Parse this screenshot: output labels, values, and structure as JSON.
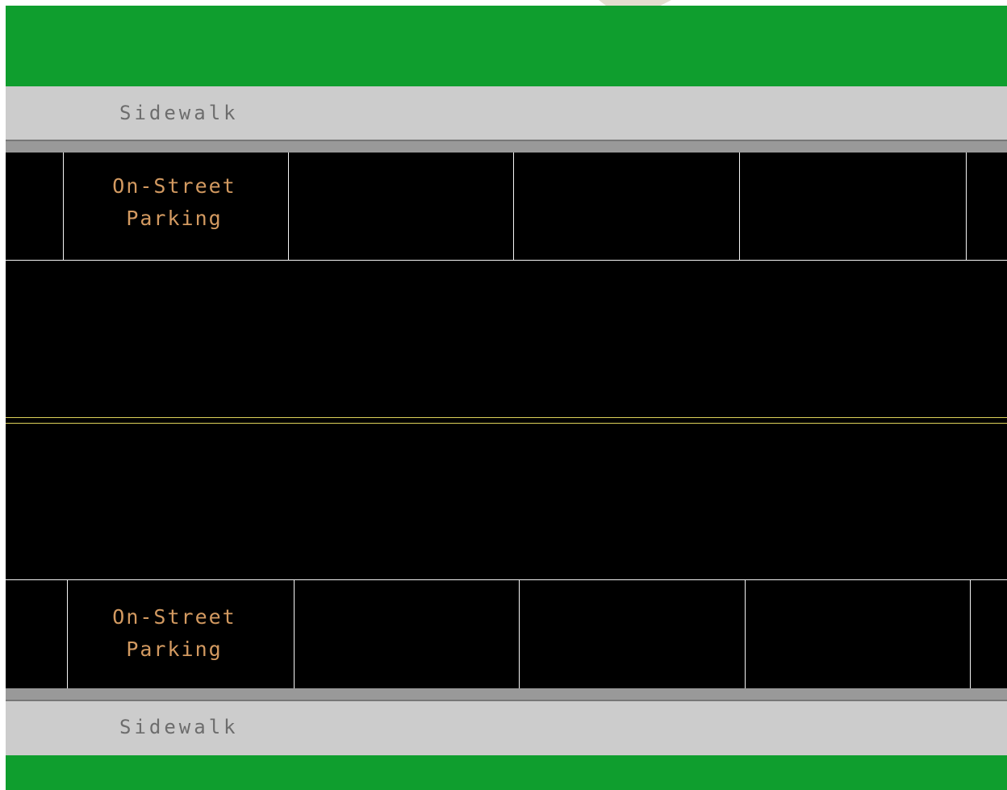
{
  "diagram": {
    "sidewalk_top_label": "Sidewalk",
    "parking_top_label": [
      "On-Street",
      "Parking"
    ],
    "parking_bottom_label": [
      "On-Street",
      "Parking"
    ],
    "sidewalk_bottom_label": "Sidewalk"
  },
  "colors": {
    "grass": "#0f9e2e",
    "sidewalk": "#cccccc",
    "curb": "#999999",
    "roadway": "#000000",
    "parking_stripe": "#f5f5f5",
    "center_line": "#ddd25a",
    "parking_label": "#d39a61",
    "sidewalk_label": "#6d6d6d"
  }
}
